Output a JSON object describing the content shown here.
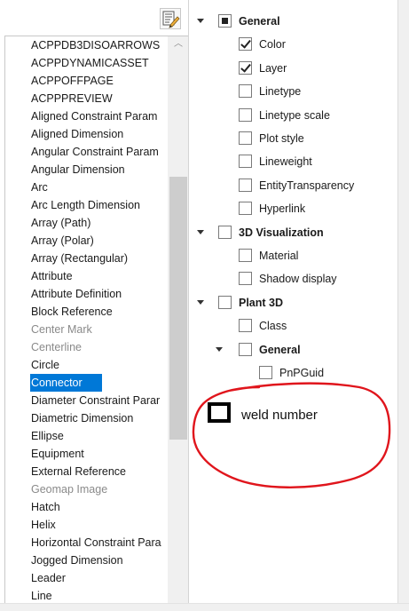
{
  "object_list": {
    "items": [
      {
        "label": "ACPPDB3DISOARROWS",
        "state": "normal"
      },
      {
        "label": "ACPPDYNAMICASSET",
        "state": "normal"
      },
      {
        "label": "ACPPOFFPAGE",
        "state": "normal"
      },
      {
        "label": "ACPPPREVIEW",
        "state": "normal"
      },
      {
        "label": "Aligned Constraint Param",
        "state": "normal"
      },
      {
        "label": "Aligned Dimension",
        "state": "normal"
      },
      {
        "label": "Angular Constraint Param",
        "state": "normal"
      },
      {
        "label": "Angular Dimension",
        "state": "normal"
      },
      {
        "label": "Arc",
        "state": "normal"
      },
      {
        "label": "Arc Length Dimension",
        "state": "normal"
      },
      {
        "label": "Array (Path)",
        "state": "normal"
      },
      {
        "label": "Array (Polar)",
        "state": "normal"
      },
      {
        "label": "Array (Rectangular)",
        "state": "normal"
      },
      {
        "label": "Attribute",
        "state": "normal"
      },
      {
        "label": "Attribute Definition",
        "state": "normal"
      },
      {
        "label": "Block Reference",
        "state": "normal"
      },
      {
        "label": "Center Mark",
        "state": "disabled"
      },
      {
        "label": "Centerline",
        "state": "disabled"
      },
      {
        "label": "Circle",
        "state": "normal"
      },
      {
        "label": "Connector",
        "state": "selected"
      },
      {
        "label": "Diameter Constraint Parar",
        "state": "normal"
      },
      {
        "label": "Diametric Dimension",
        "state": "normal"
      },
      {
        "label": "Ellipse",
        "state": "normal"
      },
      {
        "label": "Equipment",
        "state": "normal"
      },
      {
        "label": "External Reference",
        "state": "normal"
      },
      {
        "label": "Geomap Image",
        "state": "disabled"
      },
      {
        "label": "Hatch",
        "state": "normal"
      },
      {
        "label": "Helix",
        "state": "normal"
      },
      {
        "label": "Horizontal Constraint Para",
        "state": "normal"
      },
      {
        "label": "Jogged Dimension",
        "state": "normal"
      },
      {
        "label": "Leader",
        "state": "normal"
      },
      {
        "label": "Line",
        "state": "normal"
      }
    ],
    "scroll_up_glyph": "︿"
  },
  "property_tree": {
    "rows": [
      {
        "id": "general",
        "label": "General",
        "bold": true,
        "arrow": true,
        "check": "partial",
        "level": 0
      },
      {
        "id": "color",
        "label": "Color",
        "bold": false,
        "arrow": false,
        "check": "checked",
        "level": 1
      },
      {
        "id": "layer",
        "label": "Layer",
        "bold": false,
        "arrow": false,
        "check": "checked",
        "level": 1
      },
      {
        "id": "linetype",
        "label": "Linetype",
        "bold": false,
        "arrow": false,
        "check": "unchecked",
        "level": 1
      },
      {
        "id": "linetype-scale",
        "label": "Linetype scale",
        "bold": false,
        "arrow": false,
        "check": "unchecked",
        "level": 1
      },
      {
        "id": "plot-style",
        "label": "Plot style",
        "bold": false,
        "arrow": false,
        "check": "unchecked",
        "level": 1
      },
      {
        "id": "lineweight",
        "label": "Lineweight",
        "bold": false,
        "arrow": false,
        "check": "unchecked",
        "level": 1
      },
      {
        "id": "entity-transparency",
        "label": "EntityTransparency",
        "bold": false,
        "arrow": false,
        "check": "unchecked",
        "level": 1
      },
      {
        "id": "hyperlink",
        "label": "Hyperlink",
        "bold": false,
        "arrow": false,
        "check": "unchecked",
        "level": 1
      },
      {
        "id": "3d-visualization",
        "label": "3D Visualization",
        "bold": true,
        "arrow": true,
        "check": "unchecked",
        "level": 0
      },
      {
        "id": "material",
        "label": "Material",
        "bold": false,
        "arrow": false,
        "check": "unchecked",
        "level": 1
      },
      {
        "id": "shadow-display",
        "label": "Shadow display",
        "bold": false,
        "arrow": false,
        "check": "unchecked",
        "level": 1
      },
      {
        "id": "plant-3d",
        "label": "Plant 3D",
        "bold": true,
        "arrow": true,
        "check": "unchecked",
        "level": 0
      },
      {
        "id": "class",
        "label": "Class",
        "bold": false,
        "arrow": false,
        "check": "unchecked",
        "level": 1
      },
      {
        "id": "plant-general",
        "label": "General",
        "bold": true,
        "arrow": true,
        "check": "unchecked",
        "level": 1
      },
      {
        "id": "pnpguid",
        "label": "PnPGuid",
        "bold": false,
        "arrow": false,
        "check": "unchecked",
        "level": 2
      }
    ]
  },
  "annotation": {
    "label": "weld number",
    "circle_color": "#e0151c"
  },
  "colors": {
    "selection": "#0078d7",
    "disabled_text": "#8a8a8a"
  }
}
